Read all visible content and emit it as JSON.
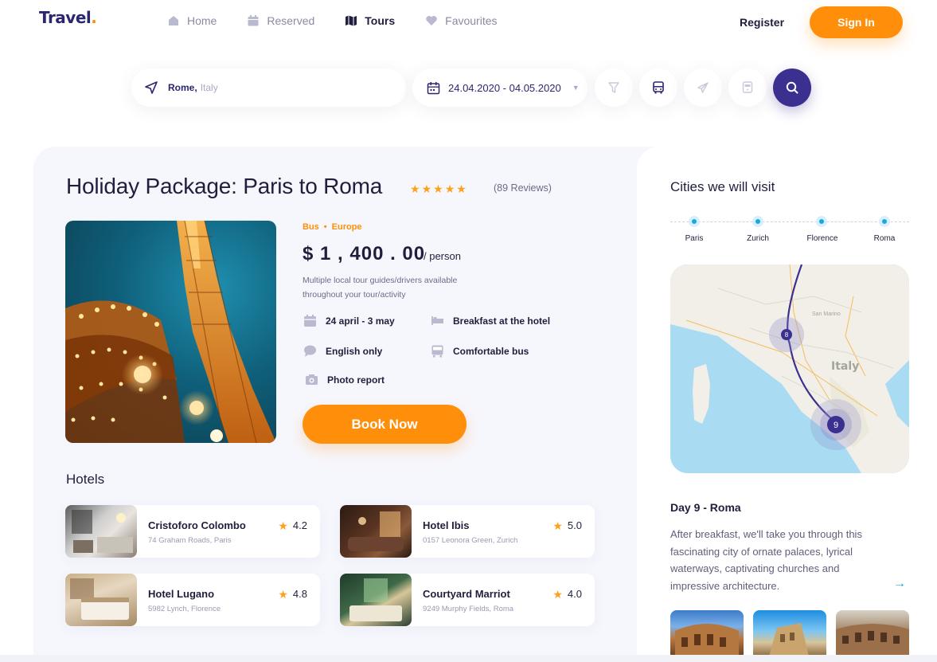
{
  "header": {
    "logo": "Travel",
    "logo_dot": ".",
    "nav": [
      {
        "label": "Home",
        "icon": "home-icon"
      },
      {
        "label": "Reserved",
        "icon": "calendar-icon"
      },
      {
        "label": "Tours",
        "icon": "map-icon",
        "active": true
      },
      {
        "label": "Favourites",
        "icon": "heart-icon"
      }
    ],
    "register": "Register",
    "sign_in": "Sign In"
  },
  "search": {
    "location_city": "Rome,",
    "location_country": "Italy",
    "dates": "24.04.2020 - 04.05.2020",
    "transport_options": [
      "filter-icon",
      "bus-icon",
      "plane-icon",
      "train-icon"
    ],
    "search_icon": "search-icon"
  },
  "tour": {
    "title": "Holiday Package: Paris to Roma",
    "rating_stars": 5,
    "reviews": "(89  Reviews)",
    "tags": [
      "Bus",
      "•",
      "Europe"
    ],
    "price": "$ 1 , 400 . 00",
    "per": "/ person",
    "description": "Multiple local tour guides/drivers available throughout your tour/activity",
    "features": {
      "dates": "24 april - 3 may",
      "breakfast": "Breakfast at the hotel",
      "language": "English only",
      "bus": "Comfortable bus",
      "photo": "Photo report"
    },
    "book_label": "Book Now"
  },
  "hotels": {
    "title": "Hotels",
    "items": [
      {
        "name": "Cristoforo Colombo",
        "address": "74 Graham Roads, Paris",
        "rating": "4.2"
      },
      {
        "name": "Hotel Ibis",
        "address": "0157 Leonora Green, Zurich",
        "rating": "5.0"
      },
      {
        "name": "Hotel Lugano",
        "address": "5982 Lynch, Florence",
        "rating": "4.8"
      },
      {
        "name": "Courtyard Marriot",
        "address": "9249 Murphy Fields, Roma",
        "rating": "4.0"
      }
    ]
  },
  "itinerary": {
    "title": "Cities we will visit",
    "cities": [
      "Paris",
      "Zurich",
      "Florence",
      "Roma"
    ],
    "map_labels": {
      "country": "Italy",
      "region": "San Marino",
      "stop_a": "8",
      "stop_b": "9"
    },
    "day_title": "Day 9 - Roma",
    "day_description": "After breakfast, we'll take you through this fascinating city of ornate palaces, lyrical waterways, captivating churches and impressive architecture.",
    "next_icon": "arrow-right-icon"
  },
  "colors": {
    "accent": "#ff8f0b",
    "primary": "#3b2f8f",
    "teal": "#1fa7d8",
    "background": "#f6f7fd"
  }
}
